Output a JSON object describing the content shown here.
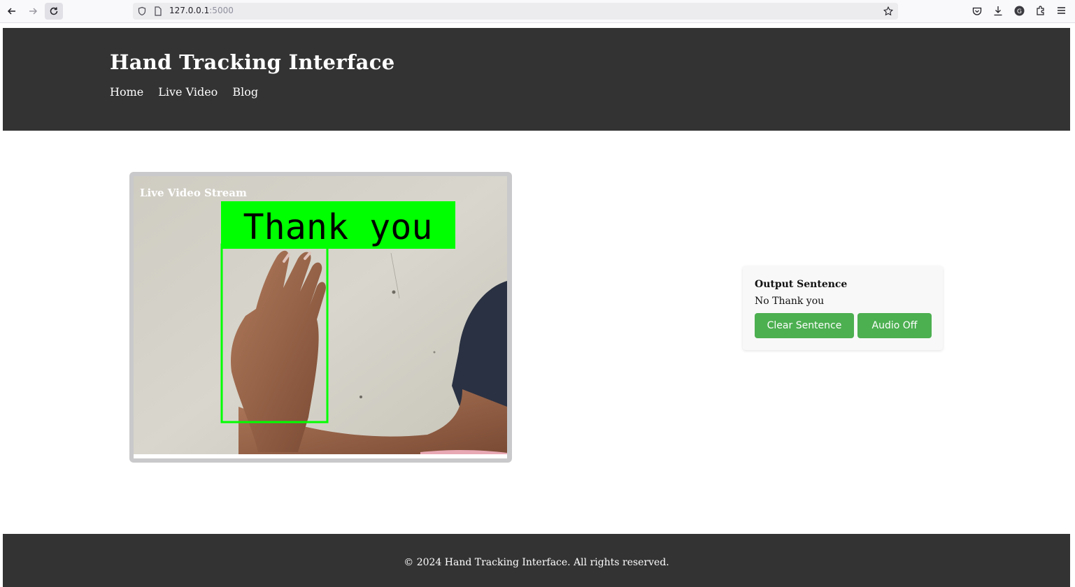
{
  "browser": {
    "url_host": "127.0.0.1",
    "url_port": ":5000"
  },
  "header": {
    "title": "Hand Tracking Interface",
    "nav": [
      "Home",
      "Live Video",
      "Blog"
    ]
  },
  "video": {
    "label": "Live Video Stream",
    "overlay_text": "Thank you"
  },
  "output": {
    "title": "Output Sentence",
    "sentence": "No Thank you",
    "clear_label": "Clear Sentence",
    "audio_label": "Audio Off"
  },
  "footer": {
    "text": "© 2024 Hand Tracking Interface. All rights reserved."
  },
  "colors": {
    "header_bg": "#333333",
    "button_bg": "#4caf50",
    "detection_green": "#00ff00"
  }
}
